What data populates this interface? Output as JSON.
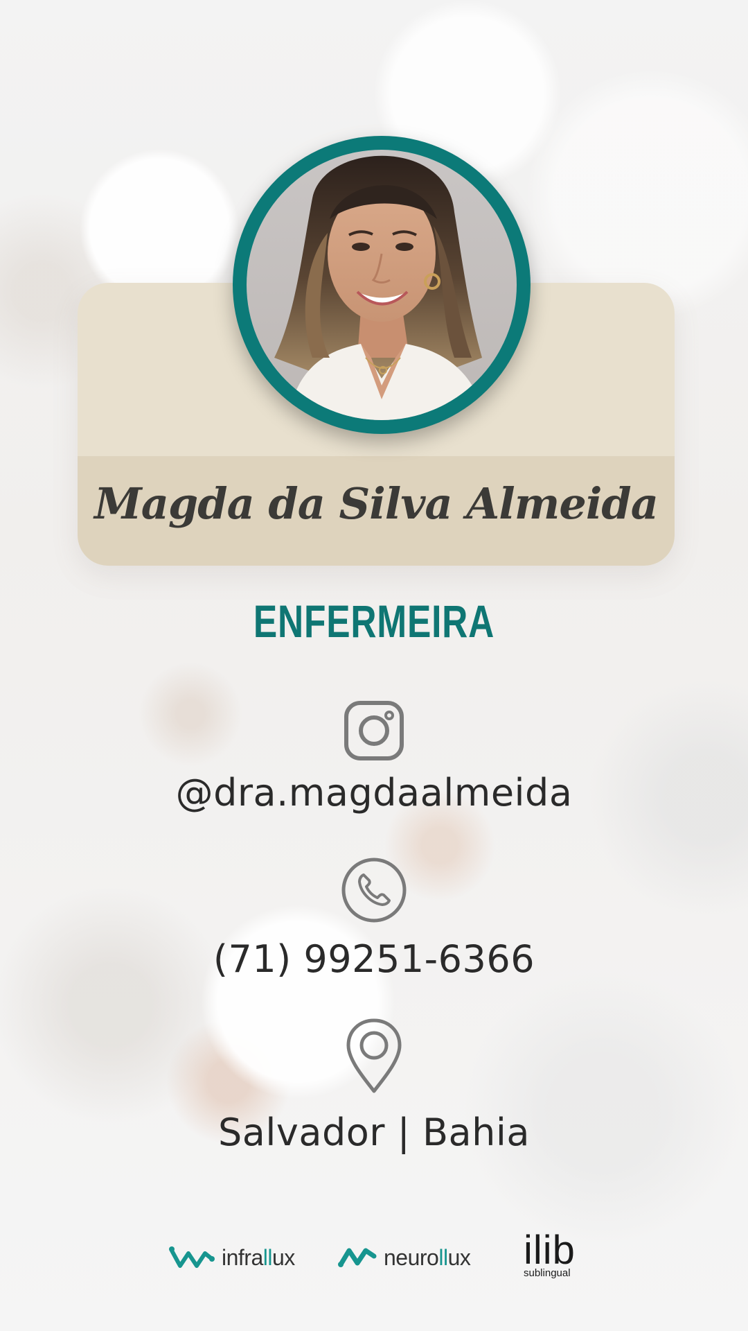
{
  "profile": {
    "name": "Magda da Silva Almeida",
    "role": "ENFERMEIRA",
    "photo_icon": "profile-photo"
  },
  "contacts": {
    "instagram": {
      "icon": "instagram-icon",
      "text": "@dra.magdaalmeida"
    },
    "phone": {
      "icon": "phone-icon",
      "text": "(71) 99251-6366"
    },
    "location": {
      "icon": "location-pin-icon",
      "text": "Salvador | Bahia"
    }
  },
  "sponsors": {
    "infralux": {
      "prefix": "infra",
      "highlight": "ll",
      "suffix": "ux"
    },
    "neurolux": {
      "prefix": "neuro",
      "highlight": "ll",
      "suffix": "ux"
    },
    "ilib": {
      "main": "ilib",
      "sub": "sublingual"
    }
  },
  "colors": {
    "accent": "#0c7a78",
    "card_top": "#e8e0ce",
    "card_bottom": "#ded3bd",
    "text_dark": "#2a2a2a",
    "icon_gray": "#7a7a7a"
  }
}
